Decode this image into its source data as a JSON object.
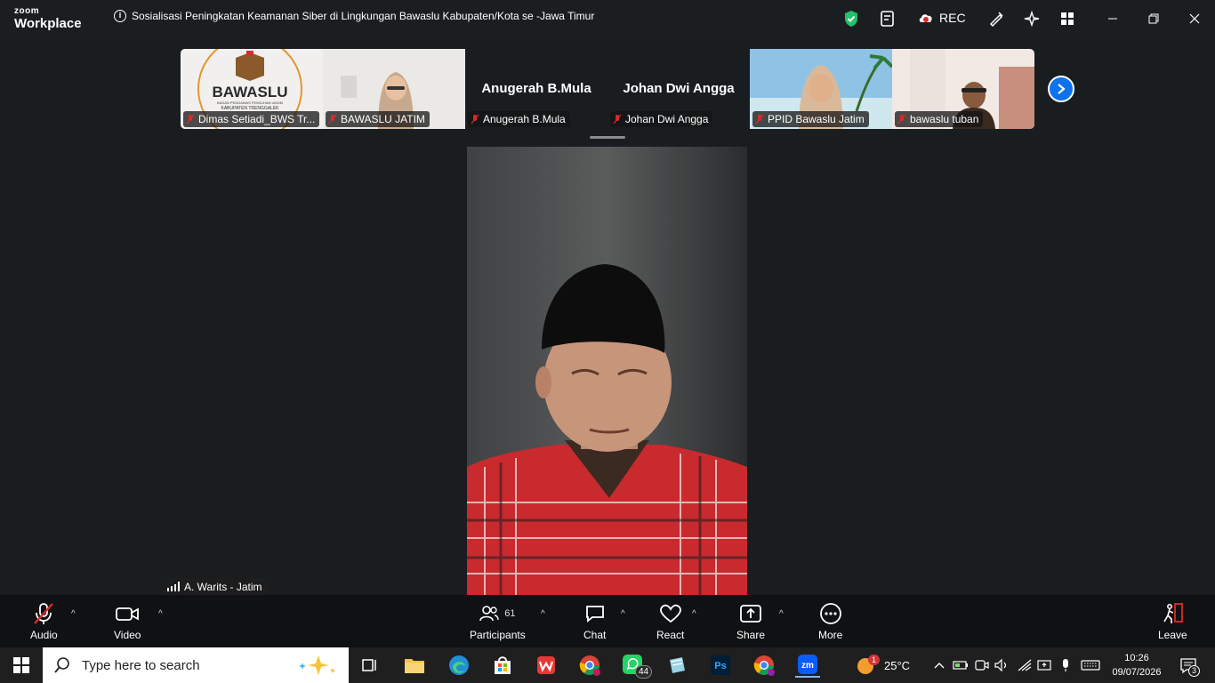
{
  "app": {
    "logo_line1": "zoom",
    "logo_line2": "Workplace",
    "meeting_title": "Sosialisasi Peningkatan Keamanan Siber di Lingkungan Bawaslu Kabupaten/Kota se -Jawa Timur",
    "rec_label": "REC"
  },
  "filmstrip": {
    "tiles": [
      {
        "name": "Dimas Setiadi_BWS Tr...",
        "logo_text": "BAWASLU",
        "logo_sub1": "BADAN PENGAWAS PEMILIHAN UMUM",
        "logo_sub2": "KABUPATEN TRENGGALEK"
      },
      {
        "name": "BAWASLU JATIM"
      },
      {
        "name": "Anugerah B.Mula",
        "big_name": "Anugerah B.Mula"
      },
      {
        "name": "Johan Dwi Angga",
        "big_name": "Johan Dwi Angga"
      },
      {
        "name": "PPID Bawaslu Jatim"
      },
      {
        "name": "bawaslu tuban"
      }
    ]
  },
  "main_speaker": {
    "name": "A. Warits - Jatim"
  },
  "toolbar": {
    "audio": "Audio",
    "video": "Video",
    "participants": "Participants",
    "participants_count": "61",
    "chat": "Chat",
    "react": "React",
    "share": "Share",
    "more": "More",
    "leave": "Leave"
  },
  "taskbar": {
    "search_placeholder": "Type here to search",
    "whatsapp_badge": "44",
    "ps_label": "Ps",
    "zoom_label": "zm",
    "weather": "25°C",
    "weather_badge": "1",
    "time": "10:26",
    "date": "09/07/2026",
    "notifications": "3"
  },
  "colors": {
    "accent": "#0e72ed",
    "muted_red": "#e02828",
    "shield_green": "#23c16b"
  }
}
